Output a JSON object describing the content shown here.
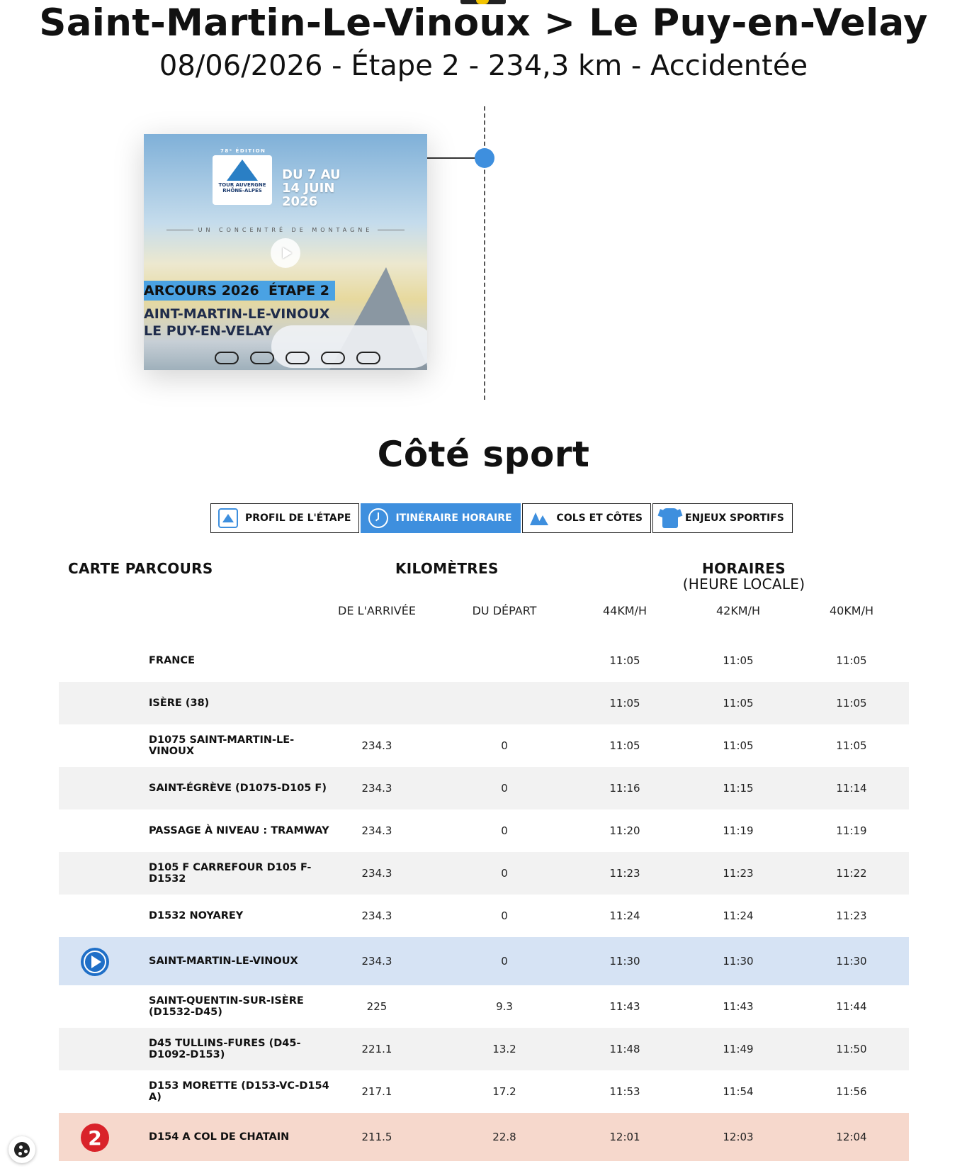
{
  "header": {
    "title": "Saint-Martin-Le-Vinoux > Le Puy-en-Velay",
    "subtitle": "08/06/2026 - Étape 2 - 234,3 km - Accidentée"
  },
  "video": {
    "edition": "78ᵉ ÉDITION",
    "logo_text": "TOUR AUVERGNE RHÔNE-ALPES",
    "dates": "DU 7 AU 14 JUIN 2026",
    "tagline": "UN CONCENTRÉ DE MONTAGNE",
    "label_course": "ARCOURS 2026",
    "label_stage": "ÉTAPE 2",
    "route_line1": "AINT-MARTIN-LE-VINOUX",
    "route_line2": "LE PUY-EN-VELAY"
  },
  "section_title": "Côté sport",
  "tabs": [
    {
      "label": "PROFIL DE L'ÉTAPE",
      "active": false
    },
    {
      "label": "ITINÉRAIRE HORAIRE",
      "active": true
    },
    {
      "label": "COLS ET CÔTES",
      "active": false
    },
    {
      "label": "ENJEUX SPORTIFS",
      "active": false
    }
  ],
  "table": {
    "col_map": "CARTE PARCOURS",
    "col_km": "KILOMÈTRES",
    "col_times": "HORAIRES",
    "col_times_sub": "(HEURE LOCALE)",
    "sub_arrival": "DE L'ARRIVÉE",
    "sub_departure": "DU DÉPART",
    "sub_44": "44KM/H",
    "sub_42": "42KM/H",
    "sub_40": "40KM/H",
    "rows": [
      {
        "place": "FRANCE",
        "arr": "",
        "dep": "",
        "t44": "11:05",
        "t42": "11:05",
        "t40": "11:05"
      },
      {
        "place": "ISÈRE (38)",
        "arr": "",
        "dep": "",
        "t44": "11:05",
        "t42": "11:05",
        "t40": "11:05"
      },
      {
        "place": "D1075 SAINT-MARTIN-LE-VINOUX",
        "arr": "234.3",
        "dep": "0",
        "t44": "11:05",
        "t42": "11:05",
        "t40": "11:05"
      },
      {
        "place": "SAINT-ÉGRÈVE (D1075-D105 F)",
        "arr": "234.3",
        "dep": "0",
        "t44": "11:16",
        "t42": "11:15",
        "t40": "11:14"
      },
      {
        "place": "PASSAGE À NIVEAU : TRAMWAY",
        "arr": "234.3",
        "dep": "0",
        "t44": "11:20",
        "t42": "11:19",
        "t40": "11:19"
      },
      {
        "place": "D105 F CARREFOUR D105 F-D1532",
        "arr": "234.3",
        "dep": "0",
        "t44": "11:23",
        "t42": "11:23",
        "t40": "11:22"
      },
      {
        "place": "D1532 NOYAREY",
        "arr": "234.3",
        "dep": "0",
        "t44": "11:24",
        "t42": "11:24",
        "t40": "11:23"
      },
      {
        "place": "SAINT-MARTIN-LE-VINOUX",
        "arr": "234.3",
        "dep": "0",
        "t44": "11:30",
        "t42": "11:30",
        "t40": "11:30",
        "badge": "start"
      },
      {
        "place": "SAINT-QUENTIN-SUR-ISÈRE (D1532-D45)",
        "arr": "225",
        "dep": "9.3",
        "t44": "11:43",
        "t42": "11:43",
        "t40": "11:44"
      },
      {
        "place": "D45 TULLINS-FURES (D45-D1092-D153)",
        "arr": "221.1",
        "dep": "13.2",
        "t44": "11:48",
        "t42": "11:49",
        "t40": "11:50"
      },
      {
        "place": "D153 MORETTE (D153-VC-D154 A)",
        "arr": "217.1",
        "dep": "17.2",
        "t44": "11:53",
        "t42": "11:54",
        "t40": "11:56"
      },
      {
        "place": "D154 A COL DE CHATAIN",
        "arr": "211.5",
        "dep": "22.8",
        "t44": "12:01",
        "t42": "12:03",
        "t40": "12:04",
        "badge": "2"
      }
    ]
  },
  "colors": {
    "accent": "#3e8fde",
    "start_row": "#d6e3f4",
    "climb_row": "#f6d8cc",
    "climb_badge": "#d9232a"
  },
  "icons": [
    "profile-icon",
    "clock-icon",
    "mountains-icon",
    "jersey-icon",
    "play-icon",
    "cookie-icon"
  ]
}
